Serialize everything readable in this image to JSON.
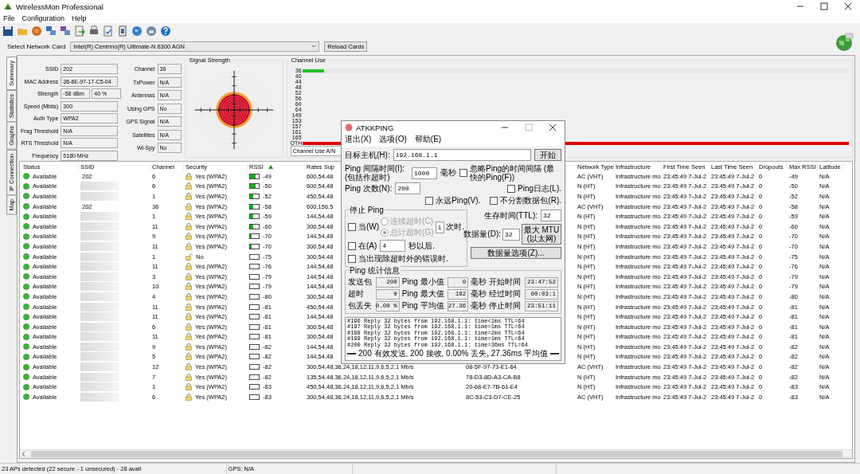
{
  "window": {
    "title": "WirelessMon Professional"
  },
  "menu": [
    "File",
    "Configuration",
    "Help"
  ],
  "network_card": {
    "label": "Select Network Card",
    "value": "Intel(R) Centrino(R) Ultimate-N 6300 AGN",
    "reload_button": "Reload Cards"
  },
  "side_tabs": [
    {
      "label": "Summary",
      "selected": true
    },
    {
      "label": "Statistics",
      "selected": false
    },
    {
      "label": "Graphs",
      "selected": false
    },
    {
      "label": "IP Connection",
      "selected": false
    },
    {
      "label": "Map",
      "selected": false
    }
  ],
  "summary": {
    "fields": [
      {
        "label": "SSID",
        "values": [
          "202"
        ]
      },
      {
        "label": "MAC Address",
        "values": [
          "36-6E-97-17-C5-04"
        ]
      },
      {
        "label": "Strength",
        "values": [
          "-58 dBm",
          "40 %"
        ]
      },
      {
        "label": "Speed (Mbits)",
        "values": [
          "300"
        ]
      },
      {
        "label": "Auth Type",
        "values": [
          "WPA2"
        ]
      },
      {
        "label": "Frag Threshold",
        "values": [
          "N/A"
        ]
      },
      {
        "label": "RTS Threshold",
        "values": [
          "N/A"
        ]
      },
      {
        "label": "Frequency",
        "values": [
          "5180 MHz"
        ]
      }
    ],
    "fields_2": [
      {
        "label": "Channel",
        "value": "36"
      },
      {
        "label": "TxPower",
        "value": "N/A"
      },
      {
        "label": "Antennas",
        "value": "N/A"
      },
      {
        "label": "Using GPS",
        "value": "No"
      },
      {
        "label": "GPS Signal",
        "value": "N/A"
      },
      {
        "label": "Satellites",
        "value": "N/A"
      },
      {
        "label": "Wi-Spy",
        "value": "No"
      }
    ]
  },
  "signal_strength": {
    "title": "Signal Strength"
  },
  "channel_use": {
    "title": "Channel Use",
    "mode": "Channel Use A/N",
    "channels": [
      {
        "label": "36",
        "level": 0.04,
        "color": "#22c322"
      },
      {
        "label": "40"
      },
      {
        "label": "44"
      },
      {
        "label": "48"
      },
      {
        "label": "52"
      },
      {
        "label": "56"
      },
      {
        "label": "60"
      },
      {
        "label": "64"
      },
      {
        "label": "149"
      },
      {
        "label": "153"
      },
      {
        "label": "157"
      },
      {
        "label": "161"
      },
      {
        "label": "165"
      },
      {
        "label": "OTH",
        "level": 1,
        "color": "#dd0000"
      }
    ]
  },
  "table": {
    "columns": [
      {
        "label": "Status",
        "sorted": false
      },
      {
        "label": "SSID",
        "sorted": false
      },
      {
        "label": "Channel",
        "sorted": false
      },
      {
        "label": "Security",
        "sorted": false
      },
      {
        "label": "RSSI",
        "sorted": true
      },
      {
        "label": "Rates Sup",
        "sorted": false
      },
      {
        "label": "Network Type",
        "sorted": false
      },
      {
        "label": "Infrastructure",
        "sorted": false
      },
      {
        "label": "First Time Seen",
        "sorted": false
      },
      {
        "label": "Last Time Seen",
        "sorted": false
      },
      {
        "label": "Dropouts",
        "sorted": false
      },
      {
        "label": "Max RSSI",
        "sorted": false
      },
      {
        "label": "Latitude",
        "sorted": false
      }
    ],
    "rows": [
      {
        "status": "Available",
        "ssid": "202",
        "redacted": false,
        "channel": "6",
        "secure": true,
        "security": "Yes (WPA2)",
        "level": 0.6,
        "rssi": "-49",
        "rates": "600,54,48",
        "network_type": "AC (VHT)",
        "infrastructure": "Infrastructure mo",
        "first_seen": "23:45:49 7-Jul-2",
        "last_seen": "23:45:49 7-Jul-2",
        "dropouts": "0",
        "max_rssi": "-49",
        "latitude": "N/A"
      },
      {
        "status": "Available",
        "redacted": true,
        "channel": "6",
        "secure": true,
        "security": "Yes (WPA2)",
        "level": 0.6,
        "rssi": "-50",
        "rates": "600,54,48",
        "network_type": "N (HT)",
        "infrastructure": "Infrastructure mo",
        "first_seen": "23:45:49 7-Jul-2",
        "last_seen": "23:45:49 7-Jul-2",
        "dropouts": "0",
        "max_rssi": "-50",
        "latitude": "N/A"
      },
      {
        "status": "Available",
        "redacted": true,
        "channel": "1",
        "secure": true,
        "security": "Yes (WPA2)",
        "level": 0.35,
        "rssi": "-52",
        "rates": "450,54,48",
        "network_type": "N (HT)",
        "infrastructure": "Infrastructure mo",
        "first_seen": "23:45:49 7-Jul-2",
        "last_seen": "23:45:49 7-Jul-2",
        "dropouts": "0",
        "max_rssi": "-52",
        "latitude": "N/A"
      },
      {
        "status": "Available",
        "ssid": "202",
        "redacted": false,
        "channel": "36",
        "secure": true,
        "security": "Yes (WPA2)",
        "level": 0.35,
        "rssi": "-58",
        "rates": "600,156,5",
        "network_type": "AC (VHT)",
        "infrastructure": "Infrastructure mo",
        "first_seen": "23:45:49 7-Jul-2",
        "last_seen": "23:45:49 7-Jul-2",
        "dropouts": "0",
        "max_rssi": "-58",
        "latitude": "N/A"
      },
      {
        "status": "Available",
        "redacted": true,
        "channel": "1",
        "secure": true,
        "security": "Yes (WPA2)",
        "level": 0.35,
        "rssi": "-59",
        "rates": "144,54,48",
        "network_type": "N (HT)",
        "infrastructure": "Infrastructure mo",
        "first_seen": "23:45:49 7-Jul-2",
        "last_seen": "23:45:49 7-Jul-2",
        "dropouts": "0",
        "max_rssi": "-59",
        "latitude": "N/A"
      },
      {
        "status": "Available",
        "redacted": true,
        "channel": "11",
        "secure": true,
        "security": "Yes (WPA2)",
        "level": 0.35,
        "rssi": "-60",
        "rates": "300,54,48",
        "network_type": "N (HT)",
        "infrastructure": "Infrastructure mo",
        "first_seen": "23:45:49 7-Jul-2",
        "last_seen": "23:45:49 7-Jul-2",
        "dropouts": "0",
        "max_rssi": "-60",
        "latitude": "N/A"
      },
      {
        "status": "Available",
        "redacted": true,
        "channel": "9",
        "secure": true,
        "security": "Yes (WPA2)",
        "level": 0.15,
        "rssi": "-70",
        "rates": "144,54,48",
        "network_type": "N (HT)",
        "infrastructure": "Infrastructure mo",
        "first_seen": "23:45:49 7-Jul-2",
        "last_seen": "23:45:49 7-Jul-2",
        "dropouts": "0",
        "max_rssi": "-70",
        "latitude": "N/A"
      },
      {
        "status": "Available",
        "redacted": true,
        "channel": "11",
        "secure": true,
        "security": "Yes (WPA2)",
        "level": 0.15,
        "rssi": "-70",
        "rates": "300,54,48",
        "network_type": "N (HT)",
        "infrastructure": "Infrastructure mo",
        "first_seen": "23:45:49 7-Jul-2",
        "last_seen": "23:45:49 7-Jul-2",
        "dropouts": "0",
        "max_rssi": "-70",
        "latitude": "N/A"
      },
      {
        "status": "Available",
        "redacted": true,
        "channel": "1",
        "secure": false,
        "security": "No",
        "rssi": "-75",
        "rates": "300,54,48",
        "network_type": "N (HT)",
        "infrastructure": "Infrastructure mo",
        "first_seen": "23:45:49 7-Jul-2",
        "last_seen": "23:45:49 7-Jul-2",
        "dropouts": "0",
        "max_rssi": "-75",
        "latitude": "N/A"
      },
      {
        "status": "Available",
        "redacted": true,
        "channel": "11",
        "secure": true,
        "security": "Yes (WPA2)",
        "rssi": "-76",
        "rates": "144,54,48",
        "network_type": "N (HT)",
        "infrastructure": "Infrastructure mo",
        "first_seen": "23:45:49 7-Jul-2",
        "last_seen": "23:45:49 7-Jul-2",
        "dropouts": "0",
        "max_rssi": "-76",
        "latitude": "N/A"
      },
      {
        "status": "Available",
        "redacted": true,
        "channel": "3",
        "secure": true,
        "security": "Yes (WPA2)",
        "rssi": "-79",
        "rates": "144,54,48",
        "network_type": "N (HT)",
        "infrastructure": "Infrastructure mo",
        "first_seen": "23:45:49 7-Jul-2",
        "last_seen": "23:45:49 7-Jul-2",
        "dropouts": "0",
        "max_rssi": "-79",
        "latitude": "N/A"
      },
      {
        "status": "Available",
        "redacted": true,
        "channel": "10",
        "secure": true,
        "security": "Yes (WPA2)",
        "rssi": "-79",
        "rates": "144,54,48",
        "network_type": "N (HT)",
        "infrastructure": "Infrastructure mo",
        "first_seen": "23:45:49 7-Jul-2",
        "last_seen": "23:45:49 7-Jul-2",
        "dropouts": "0",
        "max_rssi": "-79",
        "latitude": "N/A"
      },
      {
        "status": "Available",
        "redacted": true,
        "channel": "4",
        "secure": true,
        "security": "Yes (WPA2)",
        "rssi": "-80",
        "rates": "300,54,48",
        "network_type": "N (HT)",
        "infrastructure": "Infrastructure mo",
        "first_seen": "23:45:49 7-Jul-2",
        "last_seen": "23:45:49 7-Jul-2",
        "dropouts": "0",
        "max_rssi": "-80",
        "latitude": "N/A"
      },
      {
        "status": "Available",
        "redacted": true,
        "channel": "11",
        "secure": true,
        "security": "Yes (WPA2)",
        "rssi": "-81",
        "rates": "450,54,48",
        "network_type": "N (HT)",
        "infrastructure": "Infrastructure mo",
        "first_seen": "23:45:49 7-Jul-2",
        "last_seen": "23:45:49 7-Jul-2",
        "dropouts": "0",
        "max_rssi": "-81",
        "latitude": "N/A"
      },
      {
        "status": "Available",
        "redacted": true,
        "channel": "11",
        "secure": true,
        "security": "Yes (WPA2)",
        "rssi": "-81",
        "rates": "144,54,48",
        "network_type": "N (HT)",
        "infrastructure": "Infrastructure mo",
        "first_seen": "23:45:49 7-Jul-2",
        "last_seen": "23:45:49 7-Jul-2",
        "dropouts": "0",
        "max_rssi": "-81",
        "latitude": "N/A"
      },
      {
        "status": "Available",
        "redacted": true,
        "channel": "6",
        "secure": true,
        "security": "Yes (WPA2)",
        "rssi": "-81",
        "rates": "300,54,48",
        "network_type": "N (HT)",
        "infrastructure": "Infrastructure mo",
        "first_seen": "23:45:49 7-Jul-2",
        "last_seen": "23:45:49 7-Jul-2",
        "dropouts": "0",
        "max_rssi": "-81",
        "latitude": "N/A"
      },
      {
        "status": "Available",
        "redacted": true,
        "channel": "11",
        "secure": true,
        "security": "Yes (WPA2)",
        "rssi": "-81",
        "rates": "300,54,48",
        "network_type": "N (HT)",
        "infrastructure": "Infrastructure mo",
        "first_seen": "23:45:49 7-Jul-2",
        "last_seen": "23:45:49 7-Jul-2",
        "dropouts": "0",
        "max_rssi": "-81",
        "latitude": "N/A"
      },
      {
        "status": "Available",
        "redacted": true,
        "channel": "9",
        "secure": true,
        "security": "Yes (WPA2)",
        "rssi": "-82",
        "rates": "144,54,48",
        "network_type": "N (HT)",
        "infrastructure": "Infrastructure mo",
        "first_seen": "23:45:49 7-Jul-2",
        "last_seen": "23:45:49 7-Jul-2",
        "dropouts": "0",
        "max_rssi": "-82",
        "latitude": "N/A"
      },
      {
        "status": "Available",
        "redacted": true,
        "channel": "5",
        "secure": true,
        "security": "Yes (WPA2)",
        "rssi": "-82",
        "rates": "144,54,48",
        "network_type": "N (HT)",
        "infrastructure": "Infrastructure mo",
        "first_seen": "23:45:49 7-Jul-2",
        "last_seen": "23:45:49 7-Jul-2",
        "dropouts": "0",
        "max_rssi": "-82",
        "latitude": "N/A"
      },
      {
        "status": "Available",
        "redacted": true,
        "channel": "12",
        "secure": true,
        "security": "Yes (WPA2)",
        "rssi": "-82",
        "rates": "300,54,48,36,24,18,12,11,9,6,5,2,1 Mb/s",
        "column_7": "08-5F-97-73-E1-64",
        "network_type": "AC (VHT)",
        "infrastructure": "Infrastructure mo",
        "first_seen": "23:45:49 7-Jul-2",
        "last_seen": "23:45:49 7-Jul-2",
        "dropouts": "0",
        "max_rssi": "-82",
        "latitude": "N/A"
      },
      {
        "status": "Available",
        "redacted": true,
        "channel": "7",
        "secure": true,
        "security": "Yes (WPA2)",
        "rssi": "-82",
        "rates": "135,54,48,36,24,18,12,11,9,6,5,2,1 Mb/s",
        "column_7": "78-D3-8D-A3-CA-B8",
        "network_type": "N (HT)",
        "infrastructure": "Infrastructure mo",
        "first_seen": "23:45:49 7-Jul-2",
        "last_seen": "23:45:49 7-Jul-2",
        "dropouts": "0",
        "max_rssi": "-82",
        "latitude": "N/A"
      },
      {
        "status": "Available",
        "redacted": true,
        "channel": "1",
        "secure": true,
        "security": "Yes (WPA2)",
        "rssi": "-83",
        "rates": "450,54,48,36,24,18,12,11,9,6,5,2,1 Mb/s",
        "column_7": "20-68-E7-7B-61-E4",
        "network_type": "N (HT)",
        "infrastructure": "Infrastructure mo",
        "first_seen": "23:45:49 7-Jul-2",
        "last_seen": "23:45:49 7-Jul-2",
        "dropouts": "0",
        "max_rssi": "-83",
        "latitude": "N/A"
      },
      {
        "status": "Available",
        "redacted": true,
        "channel": "6",
        "secure": true,
        "security": "Yes (WPA2)",
        "rssi": "-83",
        "rates": "300,54,48,36,24,18,12,11,9,6,5,2,1 Mb/s",
        "column_7": "8C-53-C3-D7-CE-25",
        "network_type": "AC (VHT)",
        "infrastructure": "Infrastructure mo",
        "first_seen": "23:45:49 7-Jul-2",
        "last_seen": "23:45:49 7-Jul-2",
        "dropouts": "0",
        "max_rssi": "-83",
        "latitude": "N/A"
      }
    ]
  },
  "ping_dialog": {
    "title": "ATKKPING",
    "menu": [
      "退出(X)",
      "选项(O)",
      "帮助(E)"
    ],
    "target": {
      "label": "目标主机(H):",
      "value": "192.168.1.1"
    },
    "start_button": "开始",
    "interval": {
      "label": "Ping 间隔时间(I): (包括作超时)",
      "value": "1000",
      "unit": "毫秒"
    },
    "count": {
      "label": "Ping 次数(N):",
      "value": "200"
    },
    "options": [
      {
        "label": "忽略Ping的时间间隔 (最快的Ping(F))",
        "checked": false
      },
      {
        "label": "Ping日志(L).",
        "checked": false
      },
      {
        "label": "永远Ping(V).",
        "checked": false
      },
      {
        "label": "不分割数据包(R).",
        "checked": false
      }
    ],
    "stop_group": {
      "title": "停止 Ping",
      "when": {
        "label": "当(W)",
        "checked": false
      },
      "modes": [
        {
          "label": "连续超时(C)",
          "selected": false,
          "disabled": true
        },
        {
          "label": "总计超时(G)",
          "selected": true,
          "disabled": true
        }
      ],
      "times": {
        "value": "1",
        "unit": "次时."
      },
      "after": {
        "label": "在(A)",
        "checked": false,
        "value": "4",
        "unit": "秒以后."
      },
      "on_error": {
        "label": "当出现除超时外的错误时.",
        "checked": false
      }
    },
    "ttl": {
      "label": "生存时间(TTL):",
      "value": "32"
    },
    "size": {
      "label": "数据量(D):",
      "value": "32"
    },
    "mtu_button": "最大 MTU (以太网)",
    "size_options_button": "数据量选项(Z)...",
    "stats": {
      "title": "Ping 统计信息",
      "rows": [
        [
          {
            "label": "发送包",
            "value": "200"
          },
          {
            "label": "Ping 最小值",
            "value": "0",
            "unit": "毫秒"
          },
          {
            "label": "开始时间",
            "value": "23:47:52"
          }
        ],
        [
          {
            "label": "超时",
            "value": "0"
          },
          {
            "label": "Ping 最大值",
            "value": "182",
            "unit": "毫秒"
          },
          {
            "label": "经过时间",
            "value": "00:03:1"
          }
        ],
        [
          {
            "label": "包丢失",
            "value": "0.00 %"
          },
          {
            "label": "Ping 平均值",
            "value": "27.36",
            "unit": "毫秒"
          },
          {
            "label": "停止时间",
            "value": "23:51:11"
          }
        ]
      ]
    },
    "log": [
      "#196 Reply 32 bytes from 192.168.1.1: time<1ms TTL=64",
      "#197 Reply 32 bytes from 192.168.1.1: time=1ms TTL=64",
      "#198 Reply 32 bytes from 192.168.1.1: time=2ms TTL=64",
      "#199 Reply 32 bytes from 192.168.1.1: time=1ms TTL=64",
      "#200 Reply 32 bytes from 192.168.1.1: time=36ms TTL=64"
    ],
    "summary": "200 有效发送,  200 接收,   0.00% 丢失,  27.36ms 平均值"
  },
  "status_bar": [
    "23 APs detected (22 secure - 1 unsecured) - 28 avail",
    "GPS: N/A"
  ]
}
